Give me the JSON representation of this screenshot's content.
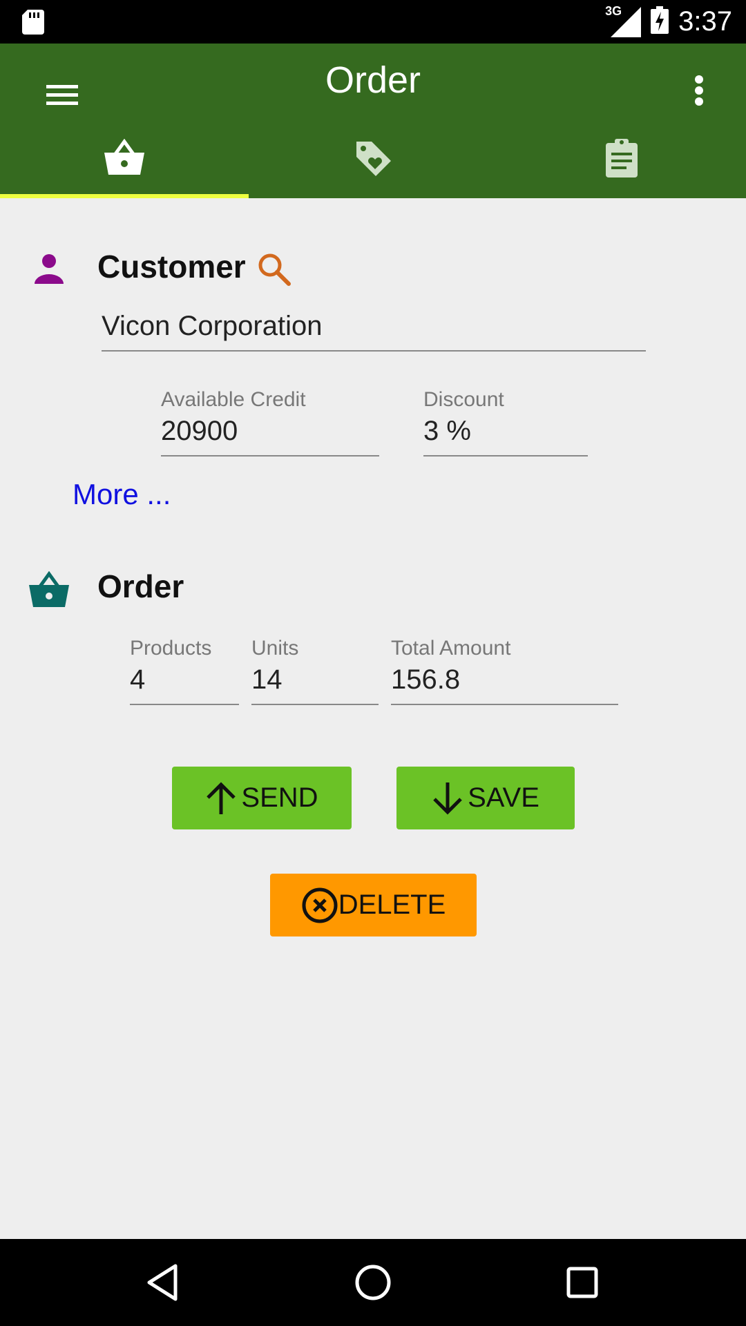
{
  "status_bar": {
    "network": "3G",
    "time": "3:37"
  },
  "app_bar": {
    "title": "Order",
    "tabs": [
      {
        "icon": "basket-icon",
        "selected": true
      },
      {
        "icon": "tag-heart-icon",
        "selected": false
      },
      {
        "icon": "clipboard-icon",
        "selected": false
      }
    ],
    "colors": {
      "bar": "#356a1f",
      "indicator": "#eeff41"
    }
  },
  "customer": {
    "title": "Customer",
    "name_value": "Vicon Corporation",
    "credit_label": "Available Credit",
    "credit_value": "20900",
    "discount_label": "Discount",
    "discount_value": "3 %",
    "more_link": "More ..."
  },
  "order": {
    "title": "Order",
    "products_label": "Products",
    "products_value": "4",
    "units_label": "Units",
    "units_value": "14",
    "total_label": "Total Amount",
    "total_value": "156.8"
  },
  "actions": {
    "send_label": "SEND",
    "save_label": "SAVE",
    "delete_label": "DELETE",
    "colors": {
      "send_save": "#6bc226",
      "delete": "#ff9800"
    }
  }
}
